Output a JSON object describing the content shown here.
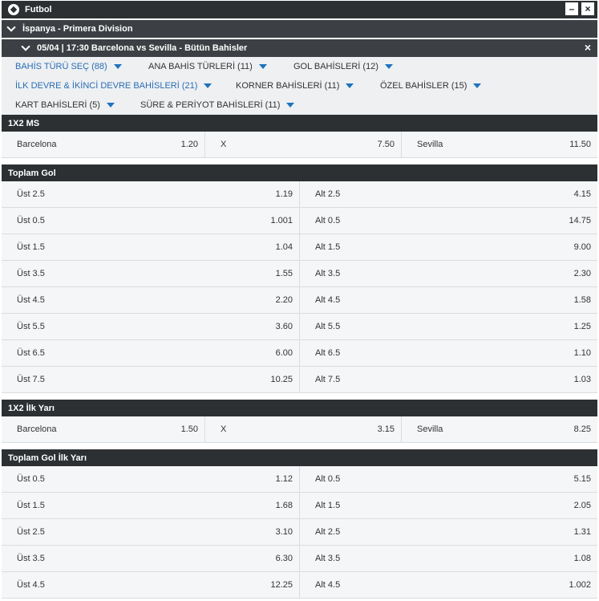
{
  "header": {
    "sport_title": "Futbol",
    "minimize_label": "–",
    "close_label": "×"
  },
  "league": {
    "title": "İspanya - Primera Division"
  },
  "event": {
    "title": "05/04 | 17:30 Barcelona vs Sevilla - Bütün Bahisler",
    "close_label": "×"
  },
  "filters": [
    {
      "label": "BAHİS TÜRÜ SEÇ (88)"
    },
    {
      "label": "ANA BAHİS TÜRLERİ (11)"
    },
    {
      "label": "GOL BAHİSLERİ (12)"
    },
    {
      "label": "İLK DEVRE & İKİNCİ DEVRE BAHİSLERİ (21)"
    },
    {
      "label": "KORNER BAHİSLERİ (11)"
    },
    {
      "label": "ÖZEL BAHİSLER (15)"
    },
    {
      "label": "KART BAHİSLERİ (5)"
    },
    {
      "label": "SÜRE & PERİYOT BAHİSLERİ (11)"
    }
  ],
  "markets": {
    "ms": {
      "title": "1X2 MS",
      "outcomes": [
        {
          "label": "Barcelona",
          "odds": "1.20"
        },
        {
          "label": "X",
          "odds": "7.50"
        },
        {
          "label": "Sevilla",
          "odds": "11.50"
        }
      ]
    },
    "total_goals": {
      "title": "Toplam Gol",
      "rows": [
        {
          "over": "Üst 2.5",
          "over_odds": "1.19",
          "under": "Alt 2.5",
          "under_odds": "4.15"
        },
        {
          "over": "Üst 0.5",
          "over_odds": "1.001",
          "under": "Alt 0.5",
          "under_odds": "14.75"
        },
        {
          "over": "Üst 1.5",
          "over_odds": "1.04",
          "under": "Alt 1.5",
          "under_odds": "9.00"
        },
        {
          "over": "Üst 3.5",
          "over_odds": "1.55",
          "under": "Alt 3.5",
          "under_odds": "2.30"
        },
        {
          "over": "Üst 4.5",
          "over_odds": "2.20",
          "under": "Alt 4.5",
          "under_odds": "1.58"
        },
        {
          "over": "Üst 5.5",
          "over_odds": "3.60",
          "under": "Alt 5.5",
          "under_odds": "1.25"
        },
        {
          "over": "Üst 6.5",
          "over_odds": "6.00",
          "under": "Alt 6.5",
          "under_odds": "1.10"
        },
        {
          "over": "Üst 7.5",
          "over_odds": "10.25",
          "under": "Alt 7.5",
          "under_odds": "1.03"
        }
      ]
    },
    "ht": {
      "title": "1X2 İlk Yarı",
      "outcomes": [
        {
          "label": "Barcelona",
          "odds": "1.50"
        },
        {
          "label": "X",
          "odds": "3.15"
        },
        {
          "label": "Sevilla",
          "odds": "8.25"
        }
      ]
    },
    "total_goals_ht": {
      "title": "Toplam Gol İlk Yarı",
      "rows": [
        {
          "over": "Üst 0.5",
          "over_odds": "1.12",
          "under": "Alt 0.5",
          "under_odds": "5.15"
        },
        {
          "over": "Üst 1.5",
          "over_odds": "1.68",
          "under": "Alt 1.5",
          "under_odds": "2.05"
        },
        {
          "over": "Üst 2.5",
          "over_odds": "3.10",
          "under": "Alt 2.5",
          "under_odds": "1.31"
        },
        {
          "over": "Üst 3.5",
          "over_odds": "6.30",
          "under": "Alt 3.5",
          "under_odds": "1.08"
        },
        {
          "over": "Üst 4.5",
          "over_odds": "12.25",
          "under": "Alt 4.5",
          "under_odds": "1.002"
        }
      ]
    }
  }
}
